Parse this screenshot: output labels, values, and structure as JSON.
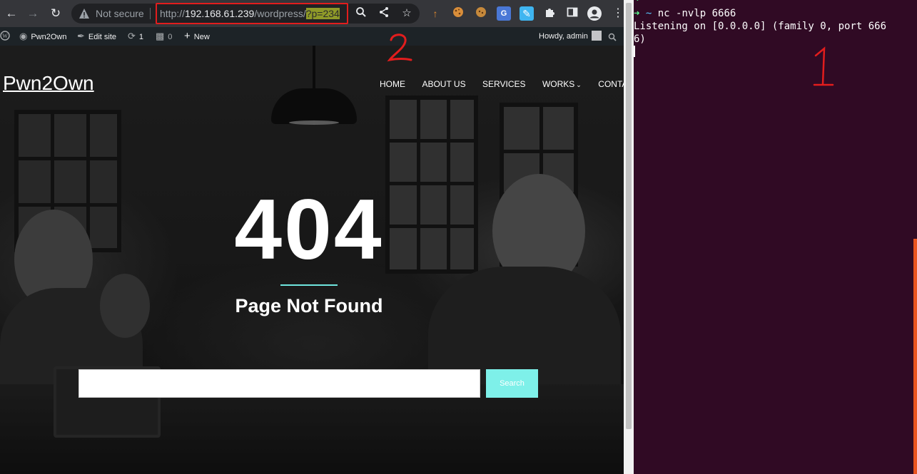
{
  "browser": {
    "security_label": "Not secure",
    "url": {
      "scheme": "http://",
      "host": "192.168.61.239",
      "path": "/wordpress/",
      "query": "?p=234"
    },
    "nav_icons": [
      "back-icon",
      "forward-icon",
      "reload-icon"
    ],
    "omnibox_icons": [
      "zoom-icon",
      "share-icon",
      "star-icon"
    ],
    "extensions": [
      "extension-arrow-icon",
      "cookie-icon",
      "cookie-editor-icon",
      "translate-icon",
      "pen-icon",
      "puzzle-icon",
      "side-panel-icon",
      "profile-icon",
      "menu-icon"
    ]
  },
  "admin_bar": {
    "site_name": "Pwn2Own",
    "edit_site": "Edit site",
    "updates_count": "1",
    "comments_count": "0",
    "new_label": "New",
    "greeting": "Howdy, admin"
  },
  "site": {
    "title": "Pwn2Own",
    "nav": [
      "HOME",
      "ABOUT US",
      "SERVICES",
      "WORKS",
      "CONTACT"
    ],
    "error_code": "404",
    "error_message": "Page Not Found",
    "search_value": "",
    "search_button": "Search"
  },
  "terminal": {
    "prompt_arrow": "➜",
    "prompt_dir": "~",
    "top_partial": "➜  ~",
    "command": "nc -nvlp 6666",
    "output_line1": "Listening on [0.0.0.0] (family 0, port 666",
    "output_line2": "6)"
  },
  "annotations": {
    "one": "1",
    "two": "2"
  },
  "colors": {
    "accent": "#7ef0e9",
    "annotation_red": "#e21d1d",
    "terminal_bg": "#300a24"
  }
}
